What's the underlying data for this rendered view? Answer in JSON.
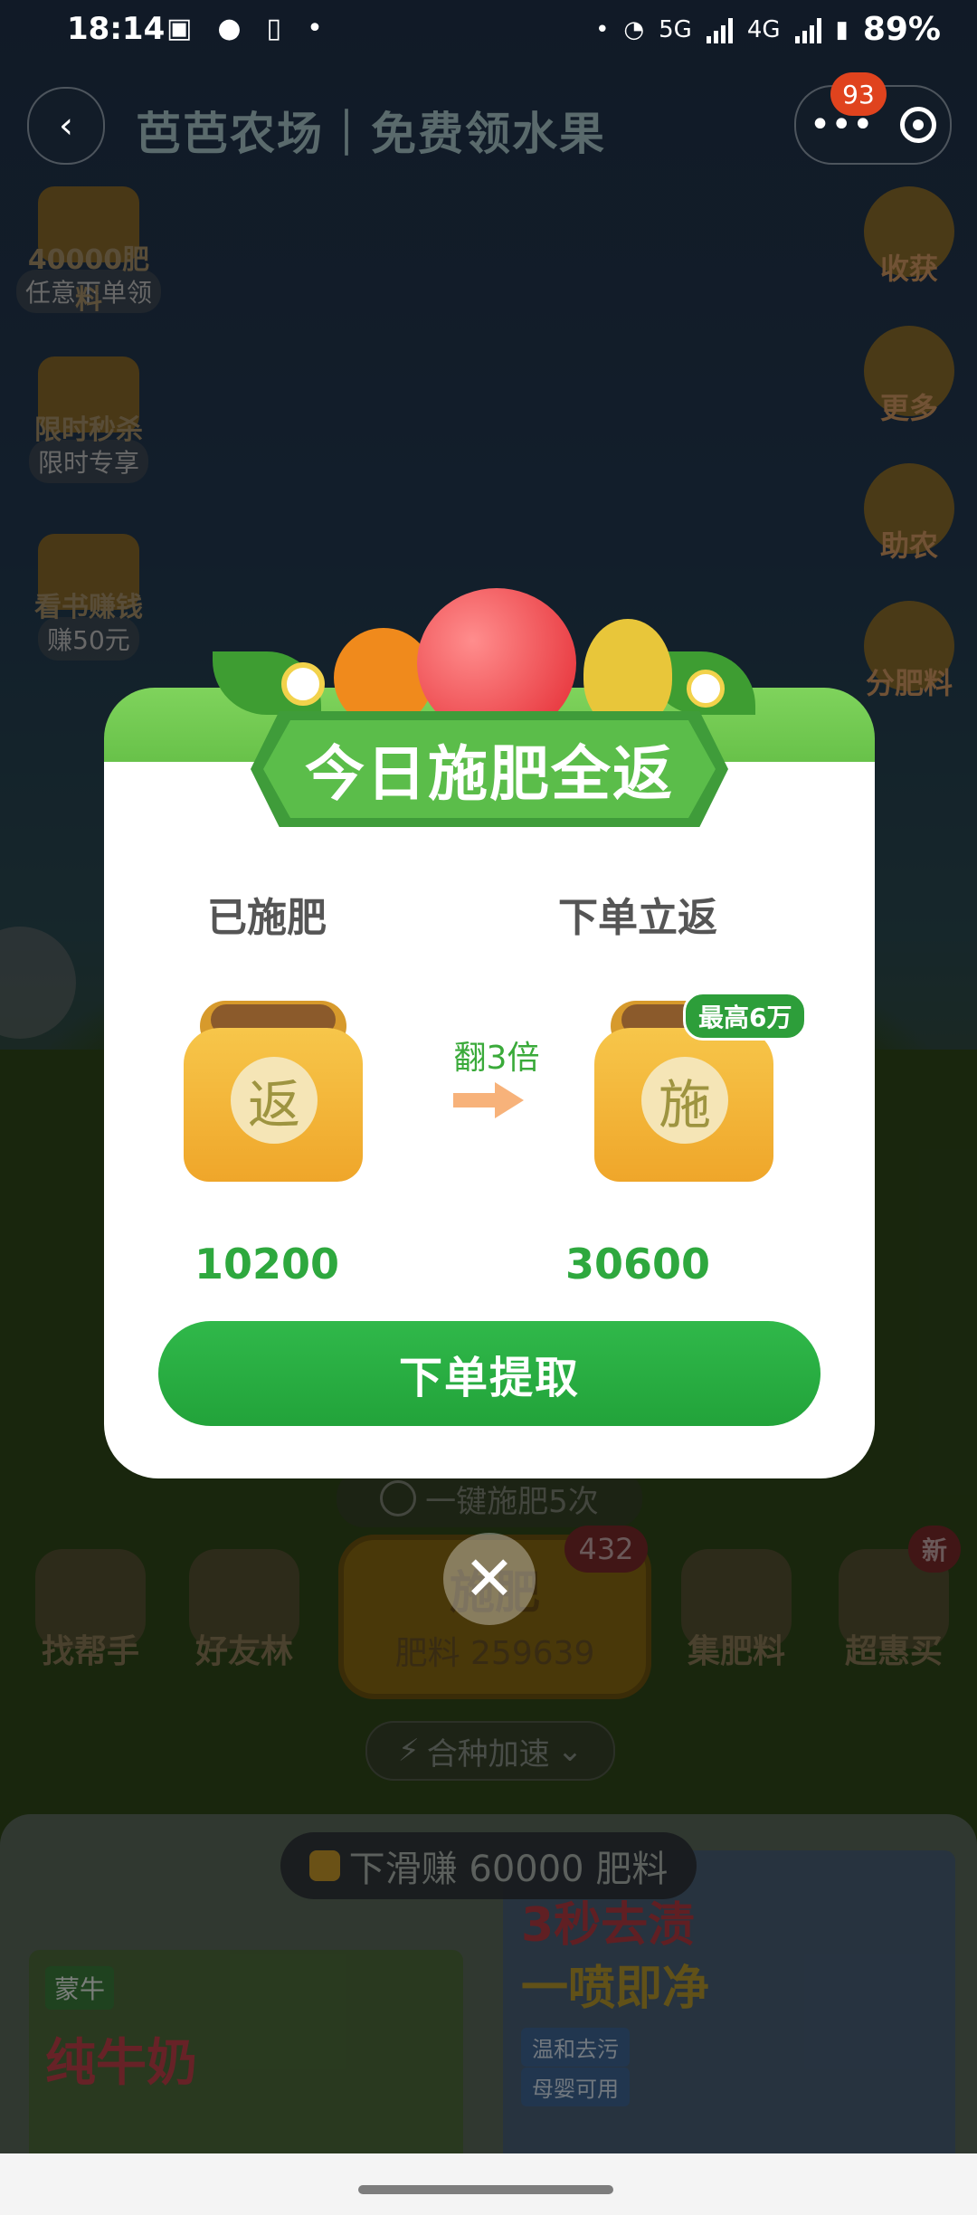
{
  "status_bar": {
    "time": "18:14",
    "network_5g": "5G",
    "network_4g": "4G",
    "battery": "89%"
  },
  "header": {
    "title": "芭芭农场｜免费领水果",
    "notif_count": "93",
    "more_icon": "•••"
  },
  "left_widgets": [
    {
      "label": "任意下单领",
      "overlay": "40000肥料"
    },
    {
      "label": "限时专享",
      "overlay": "限时秒杀"
    },
    {
      "label": "赚50元",
      "overlay": "看书赚钱"
    }
  ],
  "right_widgets": [
    {
      "label": "收获"
    },
    {
      "label": "更多"
    },
    {
      "label": "助农"
    },
    {
      "label": "分肥料"
    }
  ],
  "modal": {
    "title": "今日施肥全返",
    "left_col_title": "已施肥",
    "right_col_title": "下单立返",
    "left_bag_char": "返",
    "right_bag_char": "施",
    "multiplier_text": "翻3倍",
    "max_badge": "最高6万",
    "left_value": "10200",
    "right_value": "30600",
    "cta_label": "下单提取",
    "close_glyph": "✕"
  },
  "farm": {
    "one_key_label": "一键施肥5次",
    "fert_btn_title": "施肥",
    "fert_btn_sub": "肥料 259639",
    "fert_badge": "432",
    "speed_label": "合种加速",
    "nav": [
      {
        "label": "找帮手"
      },
      {
        "label": "好友林"
      },
      {
        "label": "集肥料"
      },
      {
        "label": "超惠买",
        "badge": "新"
      }
    ]
  },
  "bottom": {
    "swipe_tip": "下滑赚 60000 肥料",
    "ad_left_brand": "蒙牛",
    "ad_left_product": "纯牛奶",
    "ad_right_h1": "3秒去渍",
    "ad_right_h2": "一喷即净",
    "ad_right_pills": [
      "温和去污",
      "母婴可用"
    ]
  },
  "colors": {
    "accent_green": "#2ea83e",
    "badge_red": "#e0431e"
  }
}
